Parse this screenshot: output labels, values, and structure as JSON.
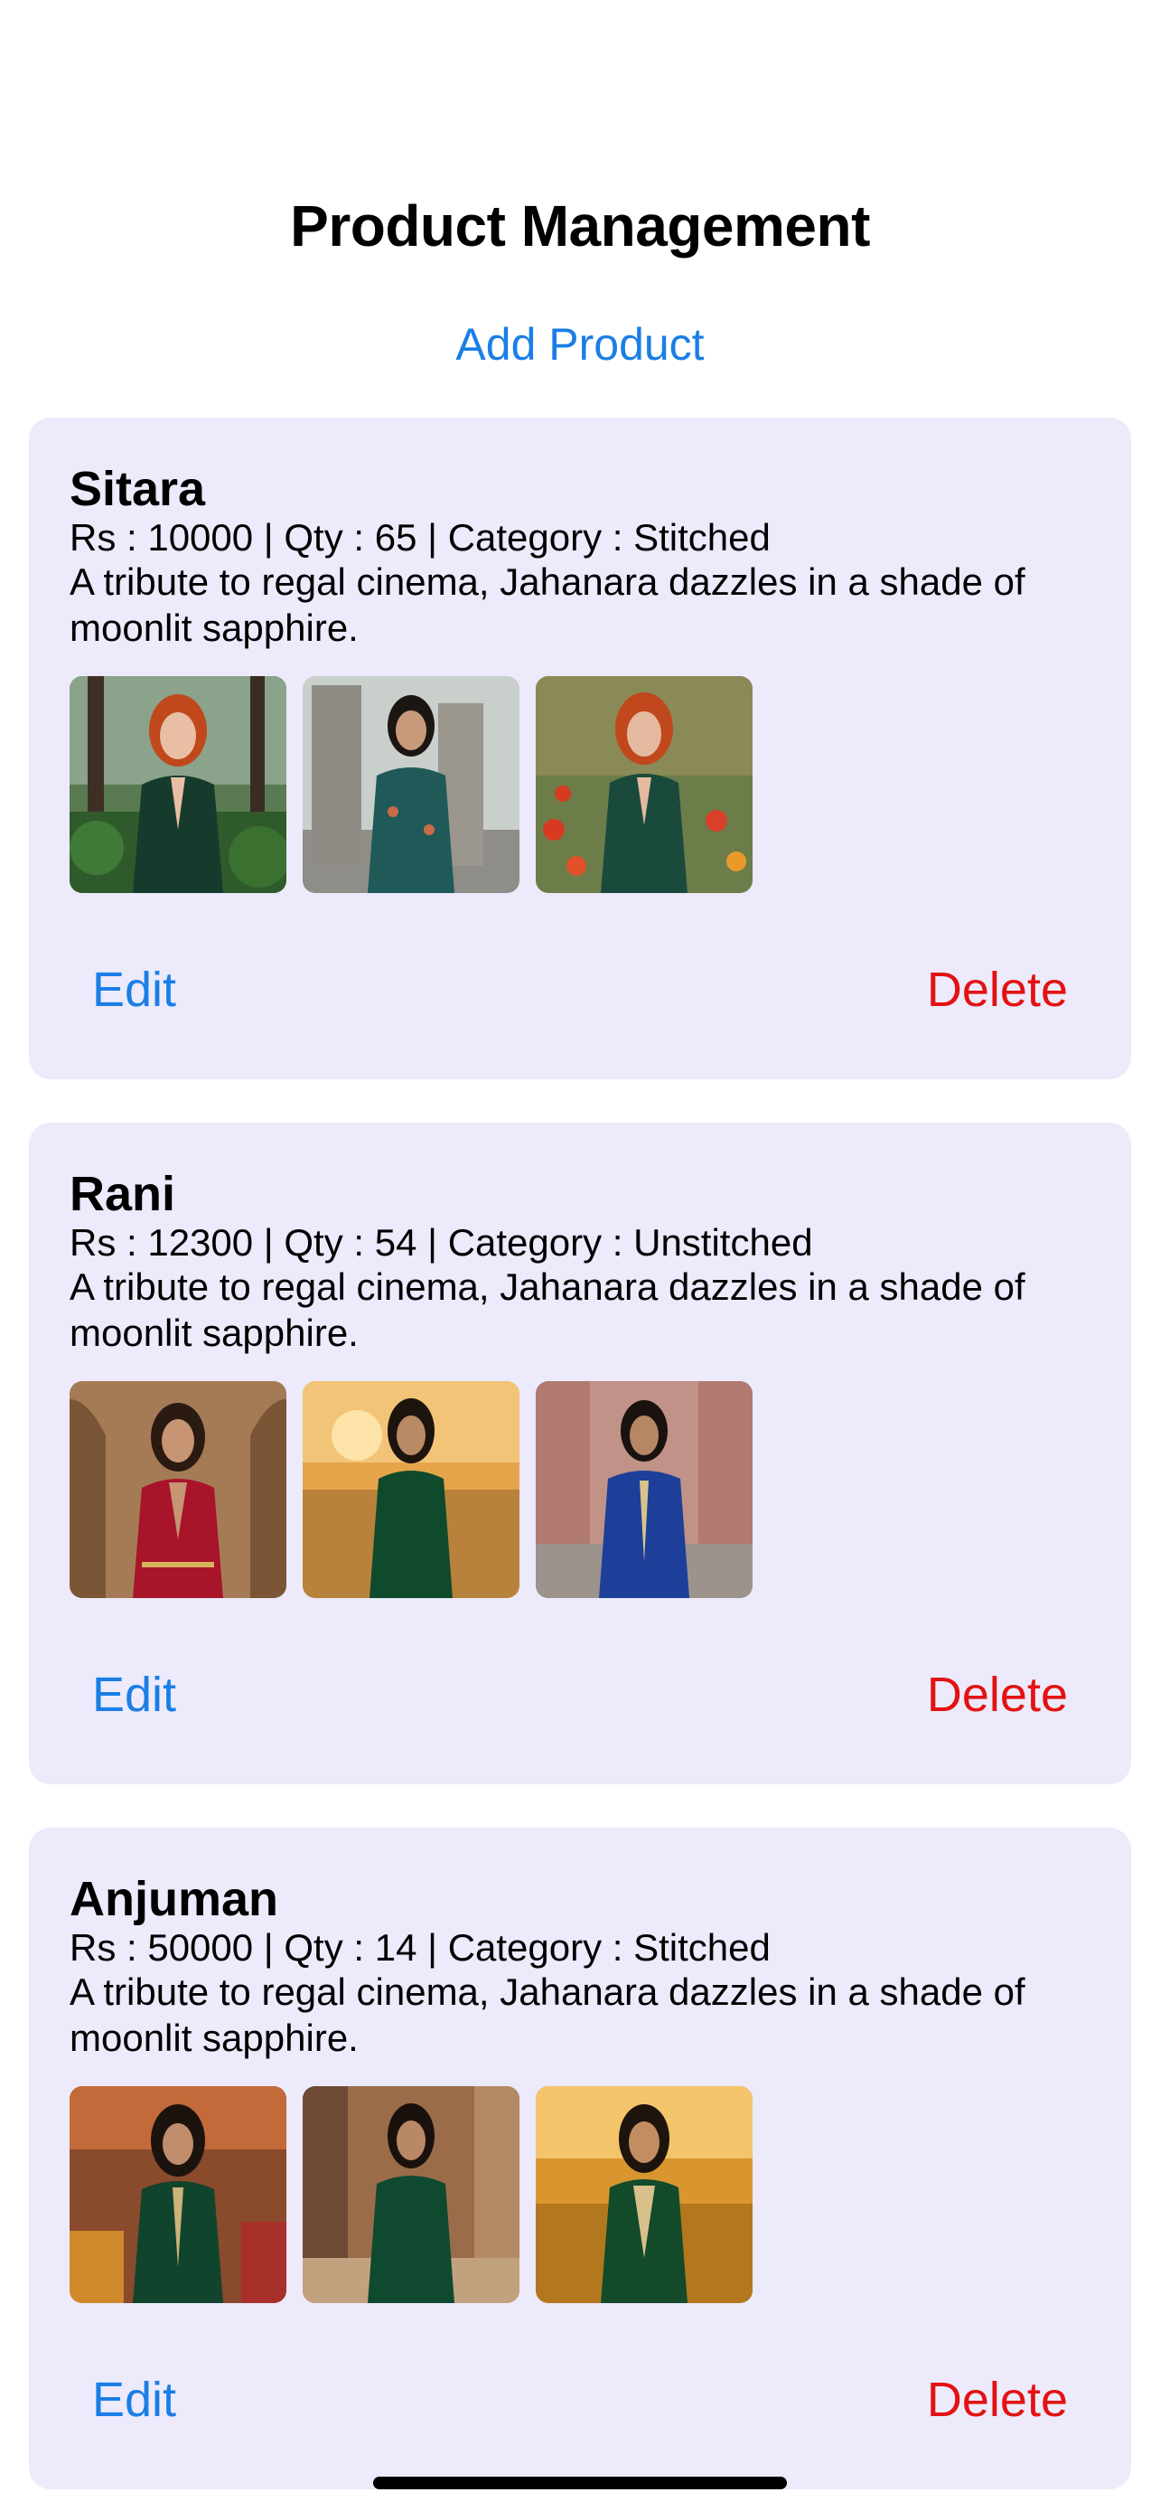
{
  "header": {
    "title": "Product Management",
    "add_product_label": "Add Product"
  },
  "products": [
    {
      "name": "Sitara",
      "meta": "Rs : 10000 | Qty : 65 | Category : Stitched",
      "description": "A tribute to regal cinema, Jahanara dazzles in a shade of moonlit sapphire.",
      "edit_label": "Edit",
      "delete_label": "Delete",
      "images": [
        {
          "subject": "red-haired woman in dark green velvet blazer in a garden"
        },
        {
          "subject": "dark-haired woman in teal embroidered suit beside stone monuments"
        },
        {
          "subject": "red-haired woman in green blazer among red flowers"
        }
      ]
    },
    {
      "name": "Rani",
      "meta": "Rs : 12300 | Qty : 54 | Category : Unstitched",
      "description": "A tribute to regal cinema, Jahanara dazzles in a shade of moonlit sapphire.",
      "edit_label": "Edit",
      "delete_label": "Delete",
      "images": [
        {
          "subject": "woman in red embroidered outfit under arches"
        },
        {
          "subject": "woman in green velvet blazer in a wheat field at sunset"
        },
        {
          "subject": "woman in royal blue embroidered kurta in a courtyard"
        }
      ]
    },
    {
      "name": "Anjuman",
      "meta": "Rs : 50000 | Qty : 14 | Category : Stitched",
      "description": "A tribute to regal cinema, Jahanara dazzles in a shade of moonlit sapphire.",
      "edit_label": "Edit",
      "delete_label": "Delete",
      "images": [
        {
          "subject": "woman in green embroidered kurta in a market street"
        },
        {
          "subject": "woman in green blazer on a street"
        },
        {
          "subject": "woman in green embroidered kurta in a golden field"
        }
      ]
    }
  ],
  "colors": {
    "accent": "#1a7ee6",
    "danger": "#e31212",
    "card_background": "#eceafb"
  }
}
